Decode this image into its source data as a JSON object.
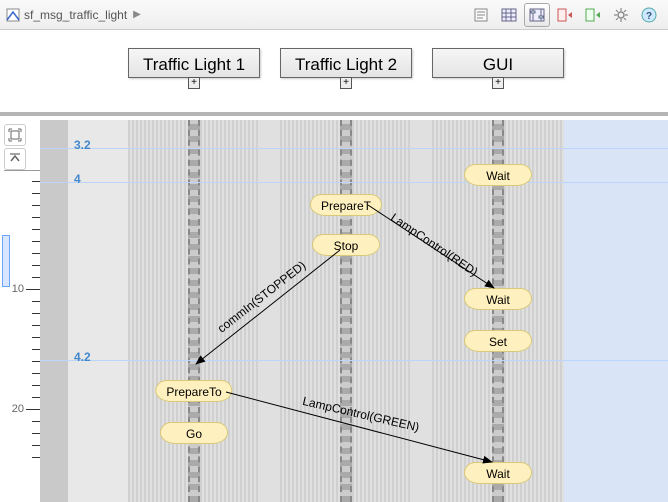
{
  "breadcrumb": {
    "model": "sf_msg_traffic_light"
  },
  "swimlanes": {
    "h1": "Traffic Light 1",
    "h2": "Traffic Light 2",
    "h3": "GUI"
  },
  "time_labels": {
    "t1": "3.2",
    "t2": "4",
    "t3": "4.2"
  },
  "ruler": {
    "mark1": "10",
    "mark2": "20"
  },
  "states": {
    "s_wait_top": "Wait",
    "s_prepare1": "PrepareT",
    "s_stop": "Stop",
    "s_wait_mid": "Wait",
    "s_set": "Set",
    "s_prepare2": "PrepareTo",
    "s_go": "Go",
    "s_wait_bot": "Wait"
  },
  "messages": {
    "m_lamp_red": "LampControl(RED)",
    "m_comm_stopped": "commIn(STOPPED)",
    "m_lamp_green": "LampControl(GREEN)"
  },
  "toolbar": {
    "text_btn": "text-view-icon",
    "table_btn": "table-view-icon",
    "chart_btn": "chart-view-icon",
    "import_red": "remove-panel-icon",
    "import_green": "add-panel-icon",
    "gear": "settings-icon",
    "help": "help-icon"
  },
  "left_controls": {
    "fit": "fit-to-view-icon",
    "collapse": "collapse-up-icon"
  }
}
